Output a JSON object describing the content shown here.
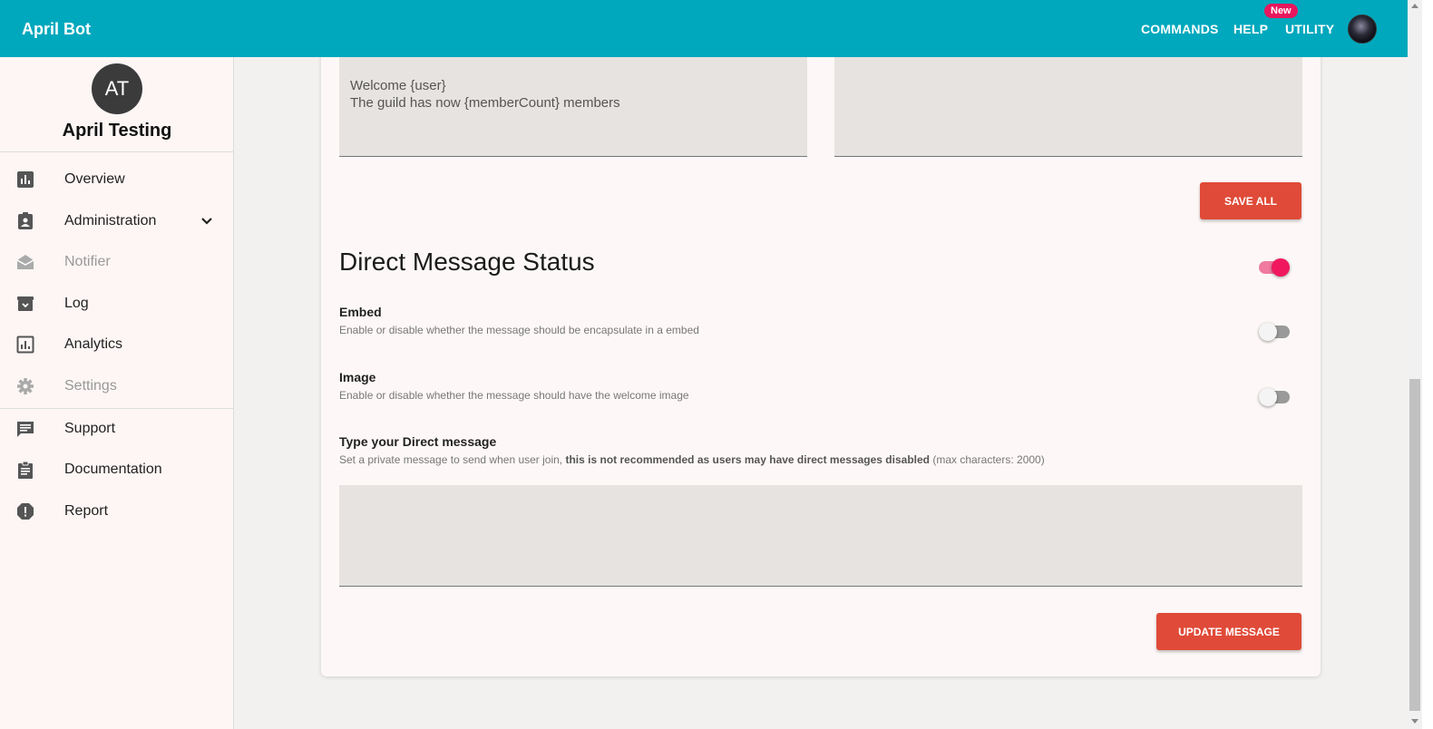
{
  "topbar": {
    "brand": "April Bot",
    "nav": {
      "commands": "COMMANDS",
      "help": "HELP",
      "utility": "UTILITY",
      "new_badge": "New"
    },
    "accent_color": "#00a8bd"
  },
  "sidebar": {
    "avatar_initials": "AT",
    "guild_name": "April Testing",
    "items": [
      {
        "label": "Overview",
        "icon": "bar-chart-icon"
      },
      {
        "label": "Administration",
        "icon": "badge-icon"
      },
      {
        "label": "Notifier",
        "icon": "mail-open-icon"
      },
      {
        "label": "Log",
        "icon": "archive-icon"
      },
      {
        "label": "Analytics",
        "icon": "analytics-icon"
      },
      {
        "label": "Settings",
        "icon": "gear-icon"
      },
      {
        "label": "Support",
        "icon": "chat-icon"
      },
      {
        "label": "Documentation",
        "icon": "clipboard-icon"
      },
      {
        "label": "Report",
        "icon": "alert-icon"
      }
    ]
  },
  "welcome": {
    "message_value": "Welcome {user}\nThe guild has now {memberCount} members",
    "second_value": "",
    "save_all_label": "SAVE ALL"
  },
  "dm": {
    "title": "Direct Message Status",
    "status_on": true,
    "embed": {
      "label": "Embed",
      "desc": "Enable or disable whether the message should be encapsulate in a embed",
      "on": false
    },
    "image": {
      "label": "Image",
      "desc": "Enable or disable whether the message should have the welcome image",
      "on": false
    },
    "message": {
      "label": "Type your Direct message",
      "desc_prefix": "Set a private message to send when user join, ",
      "desc_bold": "this is not recommended as users may have direct messages disabled",
      "desc_suffix": " (max characters: 2000)",
      "value": ""
    },
    "update_label": "UPDATE MESSAGE"
  },
  "colors": {
    "button": "#e04a38",
    "toggle_on": "#f0175e"
  }
}
